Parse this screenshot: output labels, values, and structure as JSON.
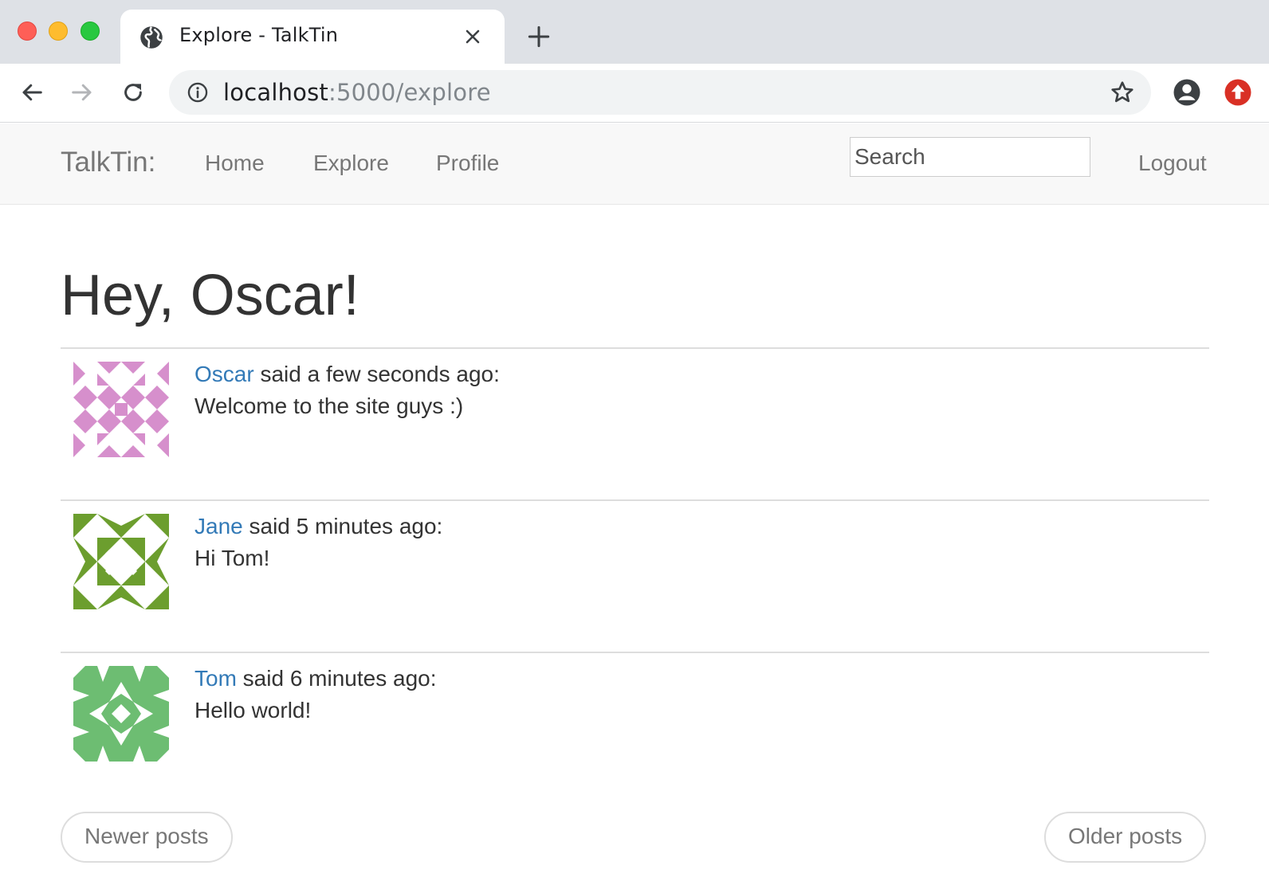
{
  "browser": {
    "tab_title": "Explore - TalkTin",
    "url_host": "localhost",
    "url_path": ":5000/explore"
  },
  "navbar": {
    "brand": "TalkTin:",
    "links": [
      "Home",
      "Explore",
      "Profile"
    ],
    "search_placeholder": "Search",
    "logout": "Logout"
  },
  "page": {
    "heading": "Hey, Oscar!"
  },
  "posts": [
    {
      "author": "Oscar",
      "meta": " said a few seconds ago:",
      "body": "Welcome to the site guys :)",
      "avatar_color": "#d68fcc"
    },
    {
      "author": "Jane",
      "meta": " said 5 minutes ago:",
      "body": "Hi Tom!",
      "avatar_color": "#6c9e2e"
    },
    {
      "author": "Tom",
      "meta": " said 6 minutes ago:",
      "body": "Hello world!",
      "avatar_color": "#6dbd72"
    }
  ],
  "pager": {
    "newer": "Newer posts",
    "older": "Older posts"
  },
  "colors": {
    "link": "#337ab7",
    "navbar_bg": "#f8f8f8",
    "chrome_tabstrip": "#dee1e6"
  }
}
